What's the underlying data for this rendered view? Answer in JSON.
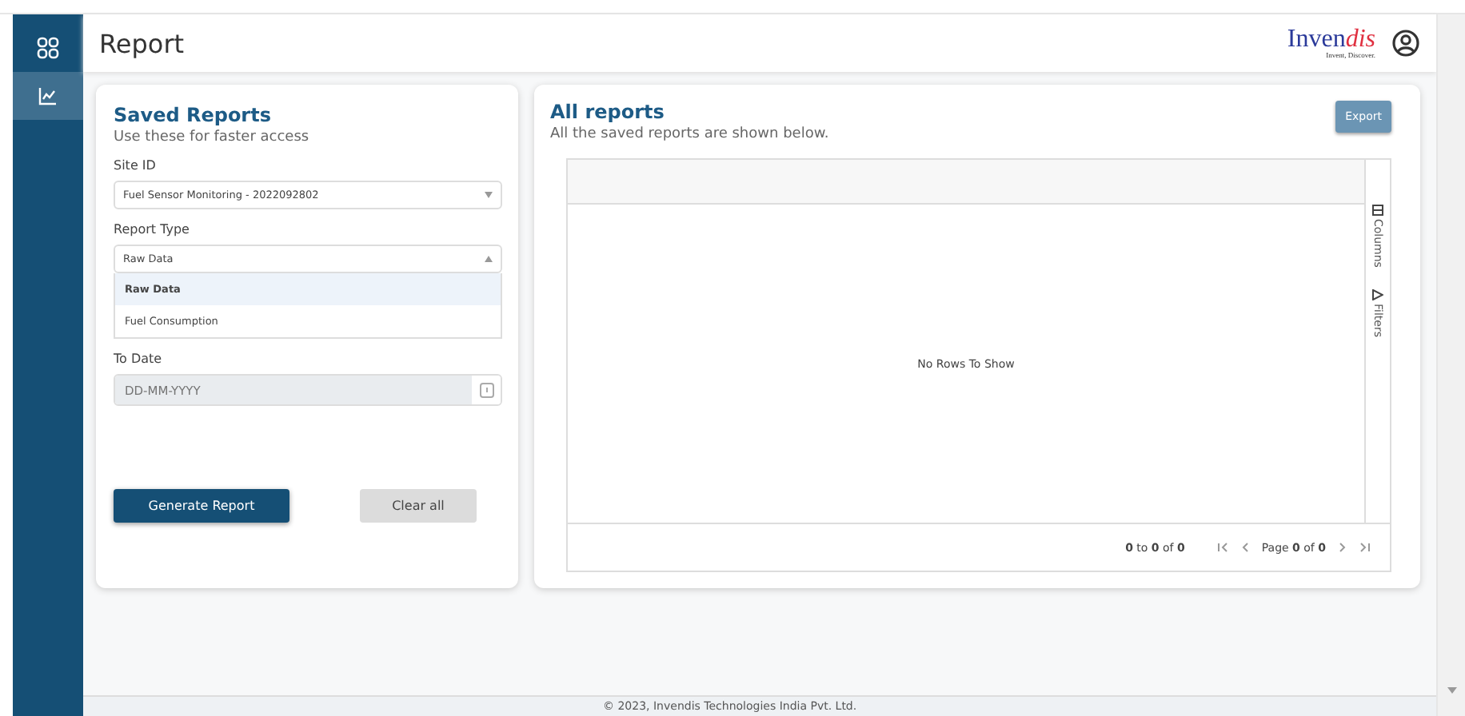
{
  "sidebar": {
    "items": [
      {
        "selected": false
      },
      {
        "selected": true
      }
    ]
  },
  "header": {
    "title": "Report",
    "logo": {
      "main": "Inven",
      "accent": "dis",
      "tagline": "Invent, Discover."
    }
  },
  "saved_reports": {
    "title": "Saved Reports",
    "subtitle": "Use these for faster access",
    "site_id": {
      "label": "Site ID",
      "value": "Fuel Sensor Monitoring - 2022092802"
    },
    "report_type": {
      "label": "Report Type",
      "value": "Raw Data",
      "expanded": true,
      "options": [
        {
          "label": "Raw Data",
          "selected": true
        },
        {
          "label": "Fuel Consumption",
          "selected": false
        }
      ]
    },
    "to_date": {
      "label": "To Date",
      "placeholder": "DD-MM-YYYY",
      "disabled": true
    },
    "buttons": [
      {
        "label": "Generate Report",
        "kind": "primary"
      },
      {
        "label": "Clear all",
        "kind": "secondary"
      }
    ]
  },
  "all_reports": {
    "title": "All reports",
    "subtitle": "All the saved reports are shown below.",
    "export": "Export",
    "grid": {
      "empty": "No Rows To Show",
      "side_tabs": [
        "Columns",
        "Filters"
      ],
      "summary": "**0** to **0** of **0**",
      "page": "Page **0** of **0**"
    }
  },
  "footer": "© 2023, Invendis Technologies India Pvt. Ltd."
}
